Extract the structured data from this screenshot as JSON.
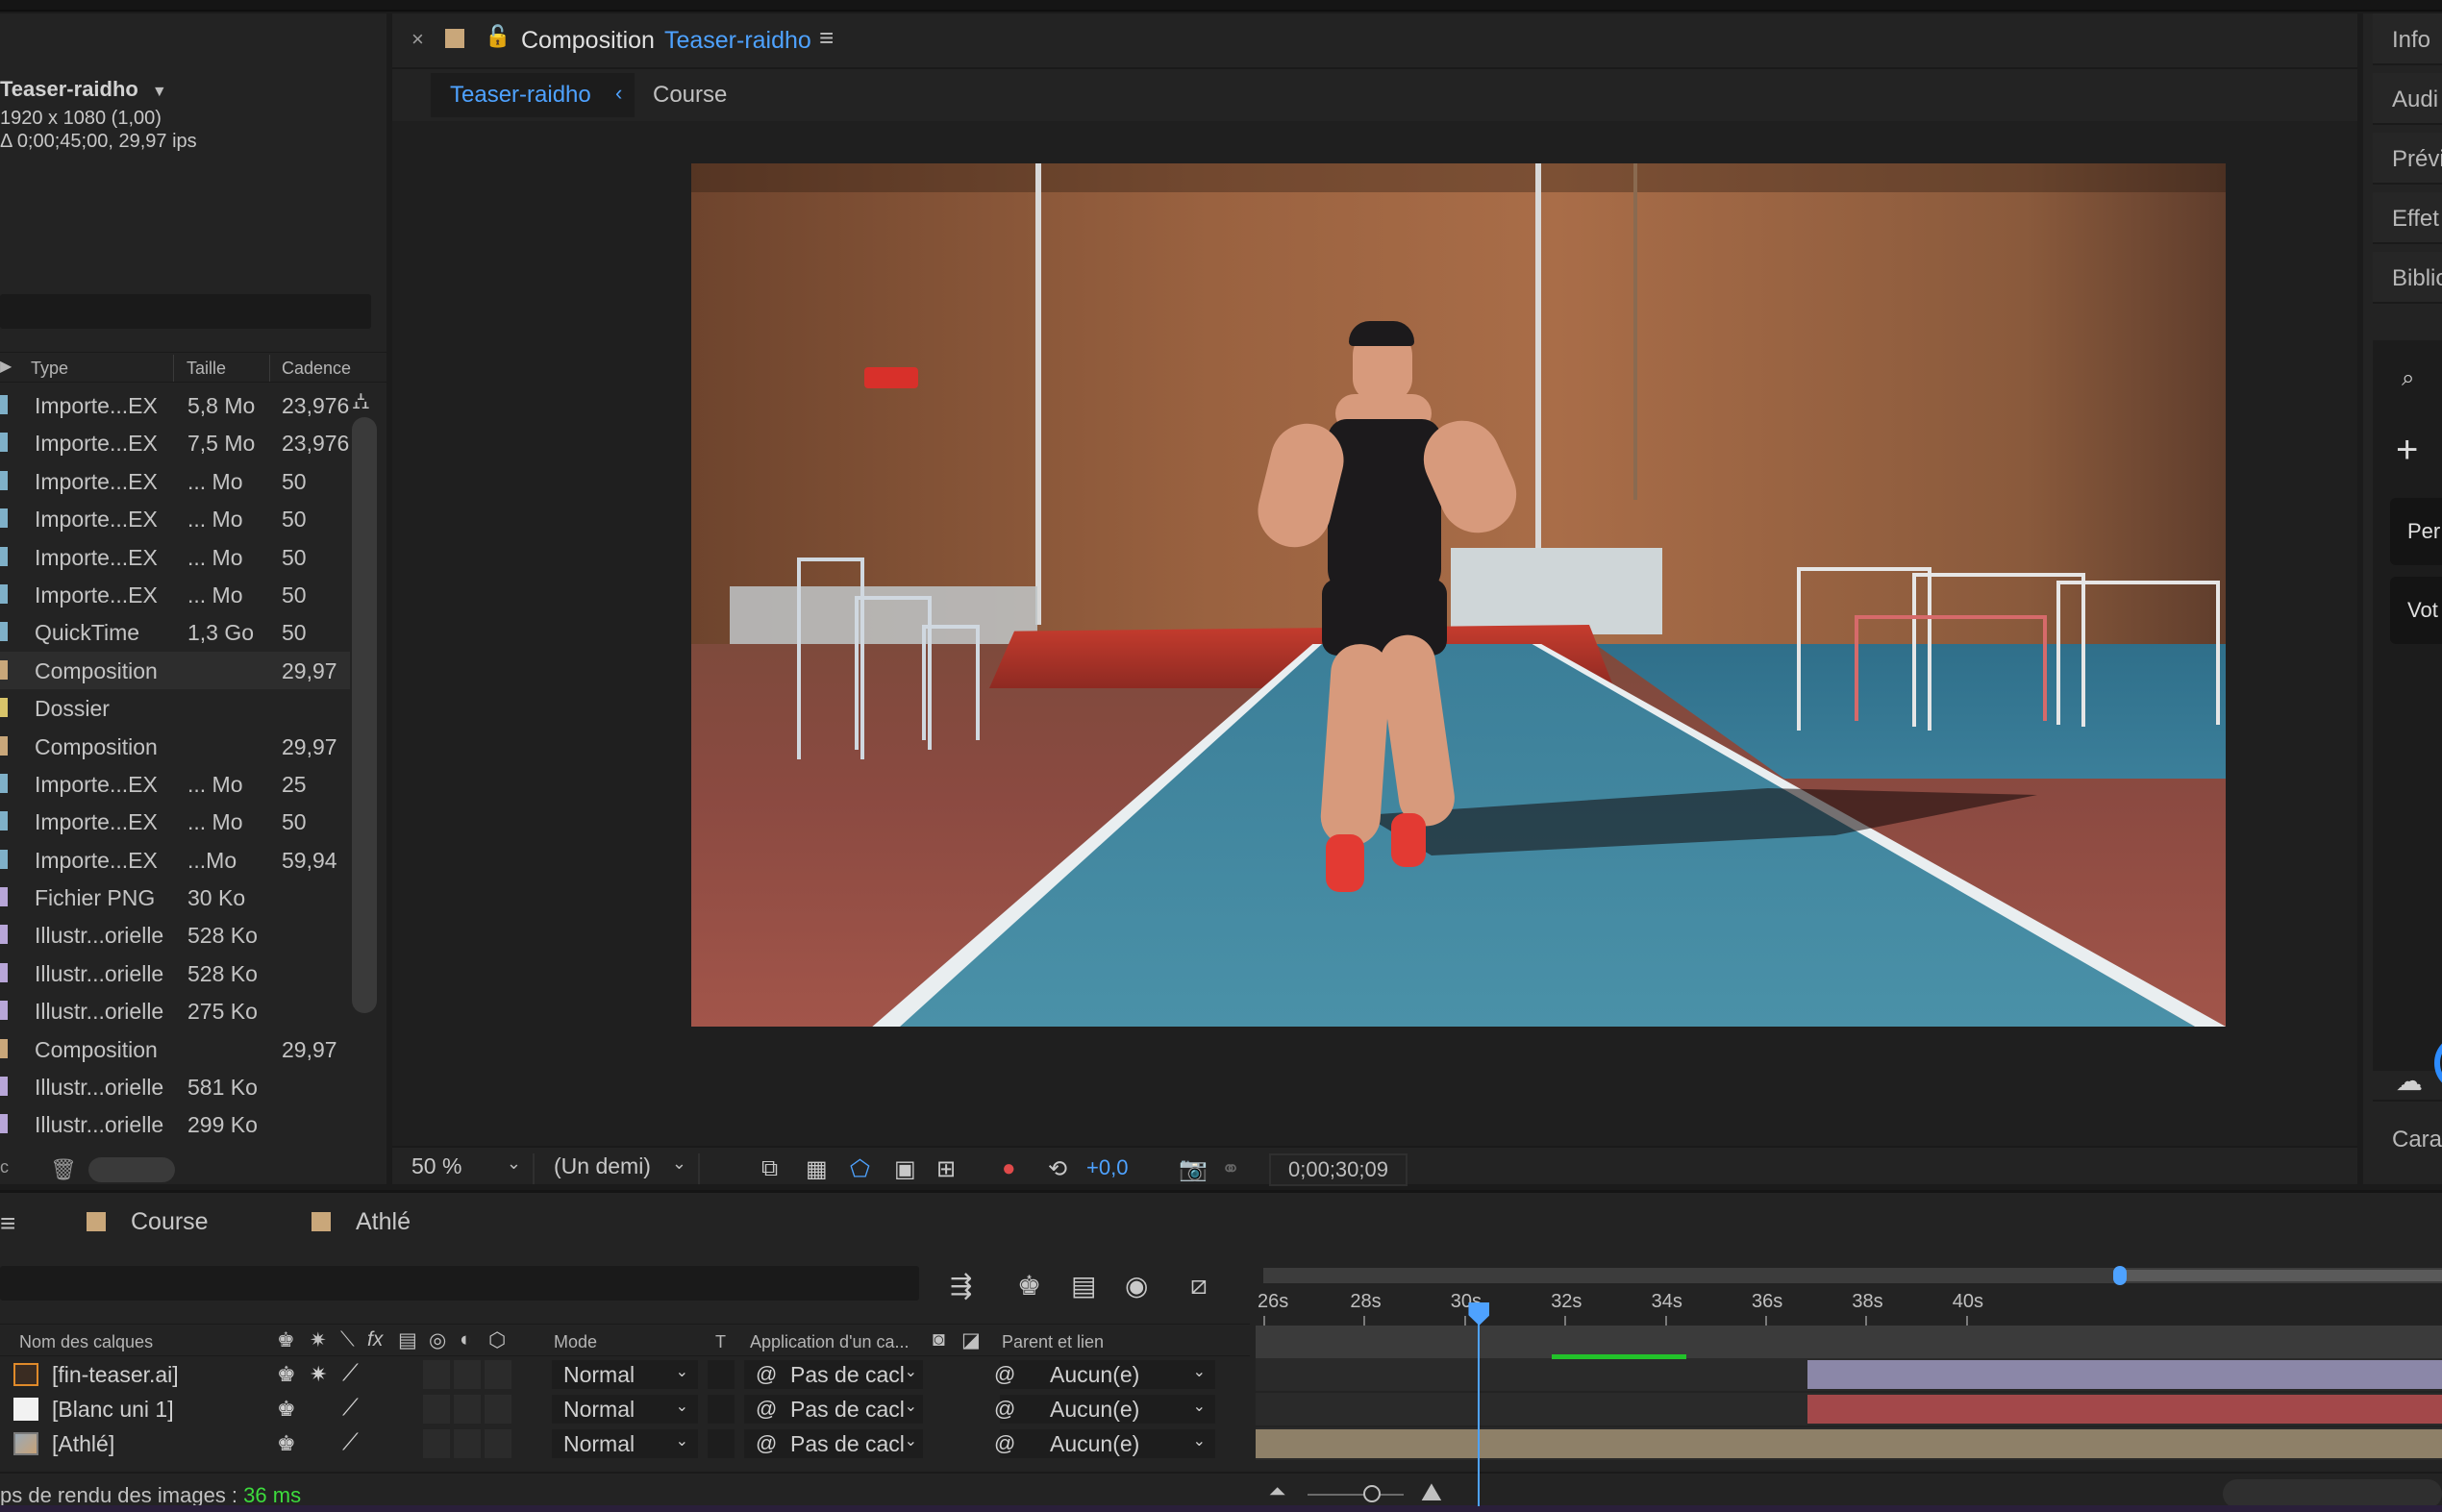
{
  "project": {
    "name": "Teaser-raidho",
    "resolution": "1920 x 1080 (1,00)",
    "duration": "Δ 0;00;45;00, 29,97 ips",
    "columns": {
      "type": "Type",
      "size": "Taille",
      "rate": "Cadence"
    },
    "items": [
      {
        "type": "Importe...EX",
        "size": "5,8 Mo",
        "rate": "23,976",
        "color": "#7fb0c8"
      },
      {
        "type": "Importe...EX",
        "size": "7,5 Mo",
        "rate": "23,976",
        "color": "#7fb0c8"
      },
      {
        "type": "Importe...EX",
        "size": "... Mo",
        "rate": "50",
        "color": "#7fb0c8"
      },
      {
        "type": "Importe...EX",
        "size": "... Mo",
        "rate": "50",
        "color": "#7fb0c8"
      },
      {
        "type": "Importe...EX",
        "size": "... Mo",
        "rate": "50",
        "color": "#7fb0c8"
      },
      {
        "type": "Importe...EX",
        "size": "... Mo",
        "rate": "50",
        "color": "#7fb0c8"
      },
      {
        "type": "QuickTime",
        "size": "1,3 Go",
        "rate": "50",
        "color": "#7fb0c8"
      },
      {
        "type": "Composition",
        "size": "",
        "rate": "29,97",
        "color": "#c9a77a",
        "selected": true
      },
      {
        "type": "Dossier",
        "size": "",
        "rate": "",
        "color": "#d8c46a"
      },
      {
        "type": "Composition",
        "size": "",
        "rate": "29,97",
        "color": "#c9a77a"
      },
      {
        "type": "Importe...EX",
        "size": "... Mo",
        "rate": "25",
        "color": "#7fb0c8"
      },
      {
        "type": "Importe...EX",
        "size": "... Mo",
        "rate": "50",
        "color": "#7fb0c8"
      },
      {
        "type": "Importe...EX",
        "size": "...Mo",
        "rate": "59,94",
        "color": "#7fb0c8"
      },
      {
        "type": "Fichier PNG",
        "size": "30 Ko",
        "rate": "",
        "color": "#b8a6d8"
      },
      {
        "type": "Illustr...orielle",
        "size": "528 Ko",
        "rate": "",
        "color": "#b8a6d8"
      },
      {
        "type": "Illustr...orielle",
        "size": "528 Ko",
        "rate": "",
        "color": "#b8a6d8"
      },
      {
        "type": "Illustr...orielle",
        "size": "275 Ko",
        "rate": "",
        "color": "#b8a6d8"
      },
      {
        "type": "Composition",
        "size": "",
        "rate": "29,97",
        "color": "#c9a77a"
      },
      {
        "type": "Illustr...orielle",
        "size": "581 Ko",
        "rate": "",
        "color": "#b8a6d8"
      },
      {
        "type": "Illustr...orielle",
        "size": "299 Ko",
        "rate": "",
        "color": "#b8a6d8"
      }
    ]
  },
  "composition": {
    "panel_label": "Composition",
    "name": "Teaser-raidho",
    "breadcrumb": [
      "Teaser-raidho",
      "Course"
    ],
    "toolbar": {
      "zoom": "50 %",
      "resolution": "(Un demi)",
      "exposure": "+0,0",
      "timecode": "0;00;30;09"
    }
  },
  "right_panel": {
    "tabs": [
      "Info",
      "Audi",
      "Prévi",
      "Effet",
      "Biblio"
    ],
    "lib_cards": [
      "Per",
      "Vot"
    ],
    "bottom_tab": "Cara"
  },
  "timeline": {
    "tabs": [
      "Course",
      "Athlé"
    ],
    "headers": {
      "layer_name": "Nom des calques",
      "mode": "Mode",
      "track": "T",
      "apply": "Application d'un ca...",
      "parent": "Parent et lien"
    },
    "ruler": [
      "26s",
      "28s",
      "30s",
      "32s",
      "34s",
      "36s",
      "38s",
      "40s"
    ],
    "playhead_seconds": 30.3,
    "layers": [
      {
        "name": "[fin-teaser.ai]",
        "mode": "Normal",
        "apply": "Pas de cacl",
        "parent": "Aucun(e)",
        "bar_color": "#8b87a8",
        "bar_start_seconds": 37.0
      },
      {
        "name": "[Blanc uni 1]",
        "mode": "Normal",
        "apply": "Pas de cacl",
        "parent": "Aucun(e)",
        "bar_color": "#a3484a",
        "bar_start_seconds": 37.0
      },
      {
        "name": "[Athlé]",
        "mode": "Normal",
        "apply": "Pas de cacl",
        "parent": "Aucun(e)",
        "bar_color": "#8e8068",
        "bar_start_seconds": 26.0
      }
    ],
    "render_label": "ps de rendu des images : ",
    "render_value": "36 ms"
  }
}
